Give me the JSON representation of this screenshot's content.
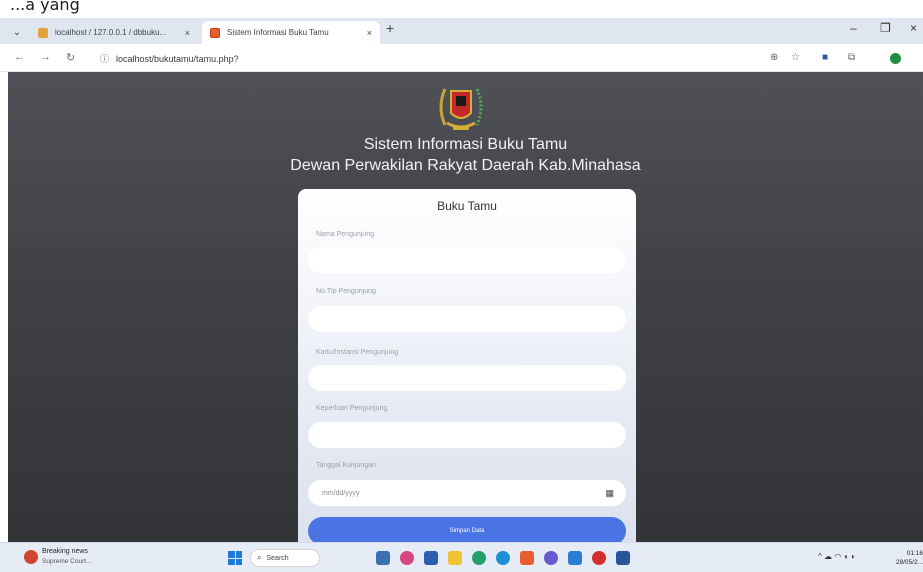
{
  "caption": {
    "text": "...a yang"
  },
  "browser": {
    "tab_list_glyph": "⌄",
    "tabs": [
      {
        "title": "localhost / 127.0.0.1 / dbbuku...",
        "close": "×"
      },
      {
        "title": "Sistem Informasi Buku Tamu",
        "close": "×"
      }
    ],
    "new_tab_glyph": "+",
    "window_controls": {
      "minimize": "–",
      "maximize": "❐",
      "close": "×"
    },
    "nav": {
      "back": "←",
      "forward": "→",
      "reload": "↻"
    },
    "site_info_glyph": "ⓘ",
    "url": "localhost/bukutamu/tamu.php?",
    "toolbar_icons": [
      "zoom-icon",
      "bookmark-star-icon",
      "extension-icon",
      "extensions-puzzle-icon",
      "profile-icon"
    ]
  },
  "page": {
    "title_line1": "Sistem Informasi Buku Tamu",
    "title_line2": "Dewan Perwakilan Rakyat Daerah Kab.Minahasa",
    "form": {
      "heading": "Buku Tamu",
      "fields": [
        {
          "label": "Nama Pengunjung",
          "value": ""
        },
        {
          "label": "No.Tlp Pengunjung",
          "value": ""
        },
        {
          "label": "Kartu/Instansi Pengunjung",
          "value": ""
        },
        {
          "label": "Keperluan Pengunjung",
          "value": ""
        },
        {
          "label": "Tanggal Kunjungan",
          "placeholder": "mm/dd/yyyy"
        }
      ],
      "calendar_glyph": "▦",
      "submit_label": "Simpan Data"
    },
    "colors": {
      "accent": "#4a73e4",
      "background_top": "#4f5156",
      "background_bottom": "#333437"
    }
  },
  "taskbar": {
    "news_title": "Breaking news",
    "news_subtitle": "Supreme Court...",
    "search_label": "Search",
    "search_glyph": "⌕",
    "tray_glyphs": "^  ☁  ◠ ◖ ◗",
    "clock_time": "01:16",
    "clock_date": "28/05/2..."
  }
}
